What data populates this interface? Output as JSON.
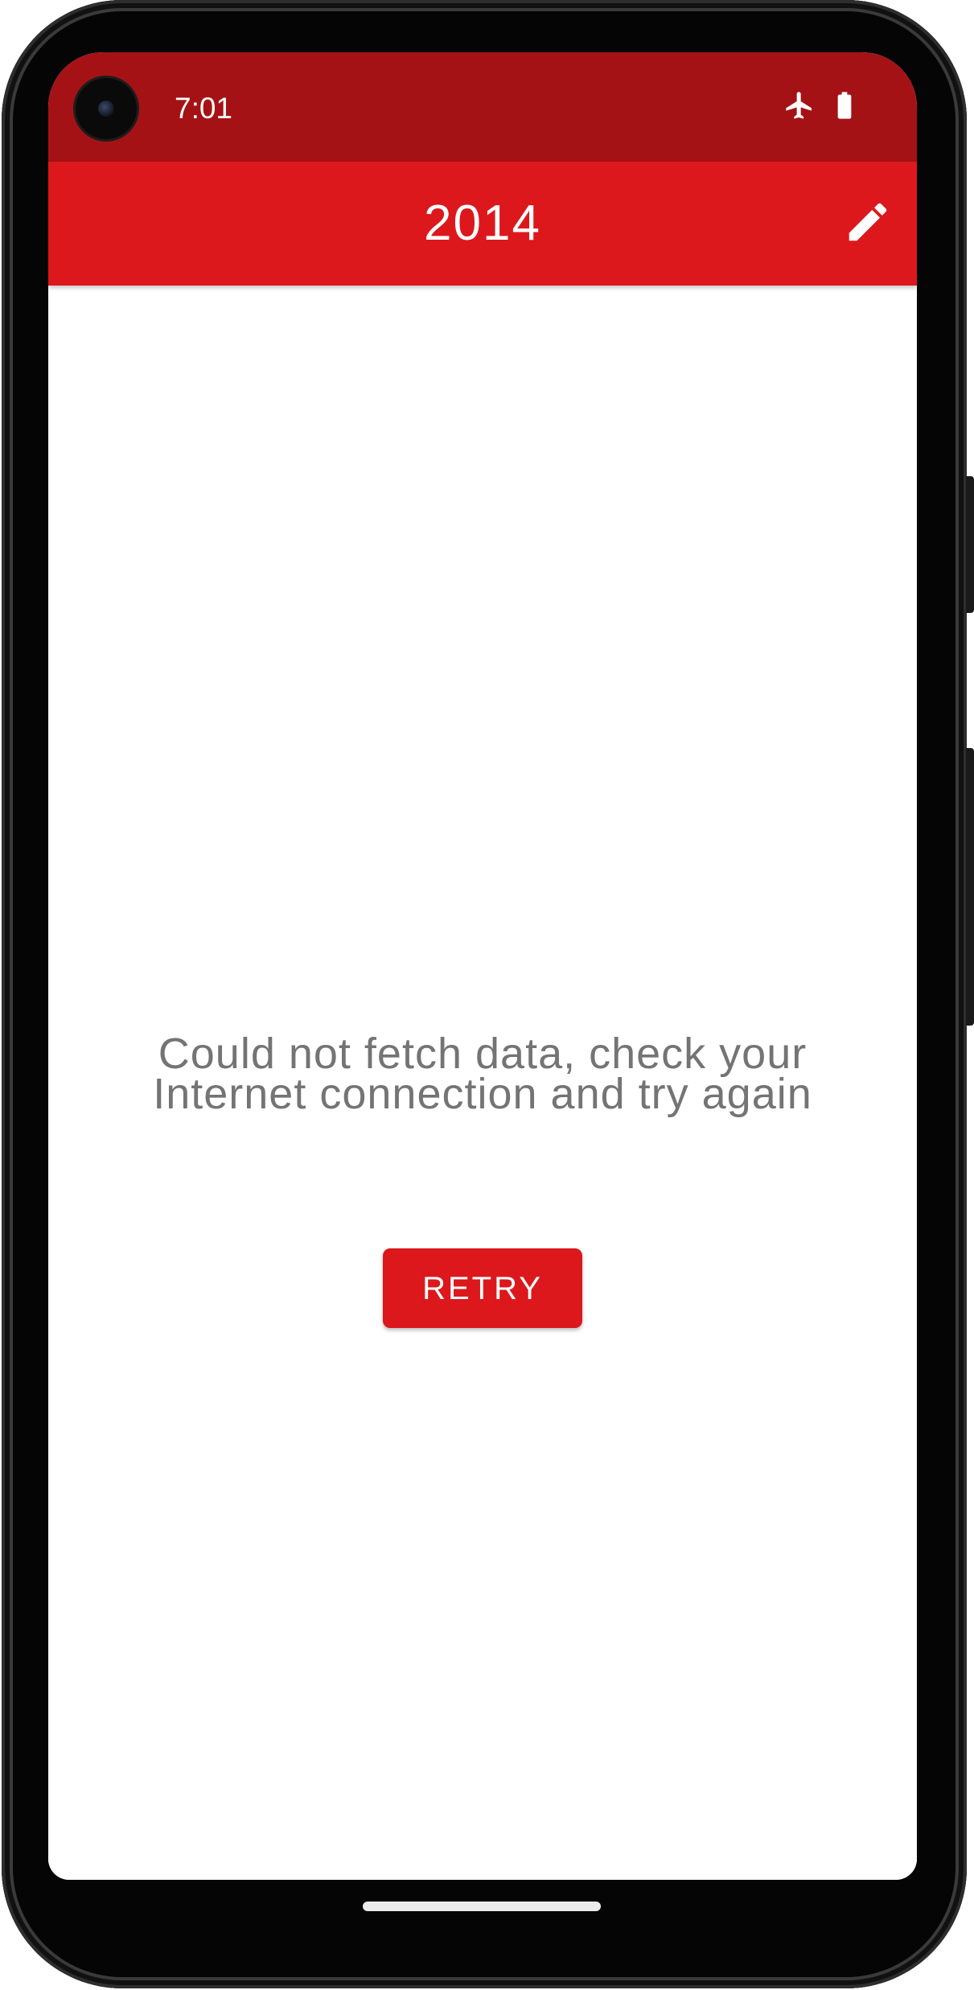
{
  "status_bar": {
    "time": "7:01",
    "icons": [
      "airplane-mode-icon",
      "battery-icon"
    ]
  },
  "app_bar": {
    "title": "2014",
    "edit_icon": "pencil-icon"
  },
  "main": {
    "error_message": "Could not fetch data, check your Internet connection and try again",
    "retry_label": "RETRY"
  },
  "colors": {
    "status_bar": "#a51215",
    "app_bar": "#dc181c",
    "retry_button": "#dc181c",
    "error_text": "#747474"
  }
}
